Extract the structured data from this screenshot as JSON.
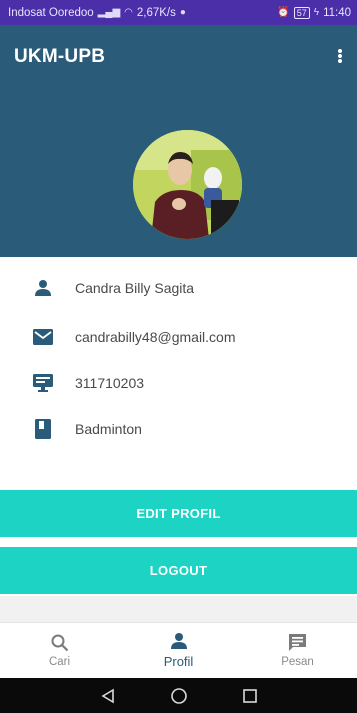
{
  "status_bar": {
    "carrier": "Indosat Ooredoo",
    "speed": "2,67K/s",
    "battery": "57",
    "time": "11:40"
  },
  "app_bar": {
    "title": "UKM-UPB",
    "menu_icon": "overflow-menu-icon"
  },
  "profile": {
    "avatar": "profile-photo",
    "fields": [
      {
        "icon": "person-icon",
        "value": "Candra Billy Sagita"
      },
      {
        "icon": "email-icon",
        "value": "candrabilly48@gmail.com"
      },
      {
        "icon": "id-card-icon",
        "value": "311710203"
      },
      {
        "icon": "book-icon",
        "value": "Badminton"
      }
    ]
  },
  "actions": {
    "edit_label": "EDIT PROFIL",
    "logout_label": "LOGOUT"
  },
  "bottom_nav": {
    "items": [
      {
        "icon": "search-icon",
        "label": "Cari",
        "active": false
      },
      {
        "icon": "person-icon",
        "label": "Profil",
        "active": true
      },
      {
        "icon": "message-icon",
        "label": "Pesan",
        "active": false
      }
    ]
  },
  "colors": {
    "status_bar": "#4a2fa8",
    "primary": "#2a5b79",
    "accent": "#1cd3c4"
  }
}
